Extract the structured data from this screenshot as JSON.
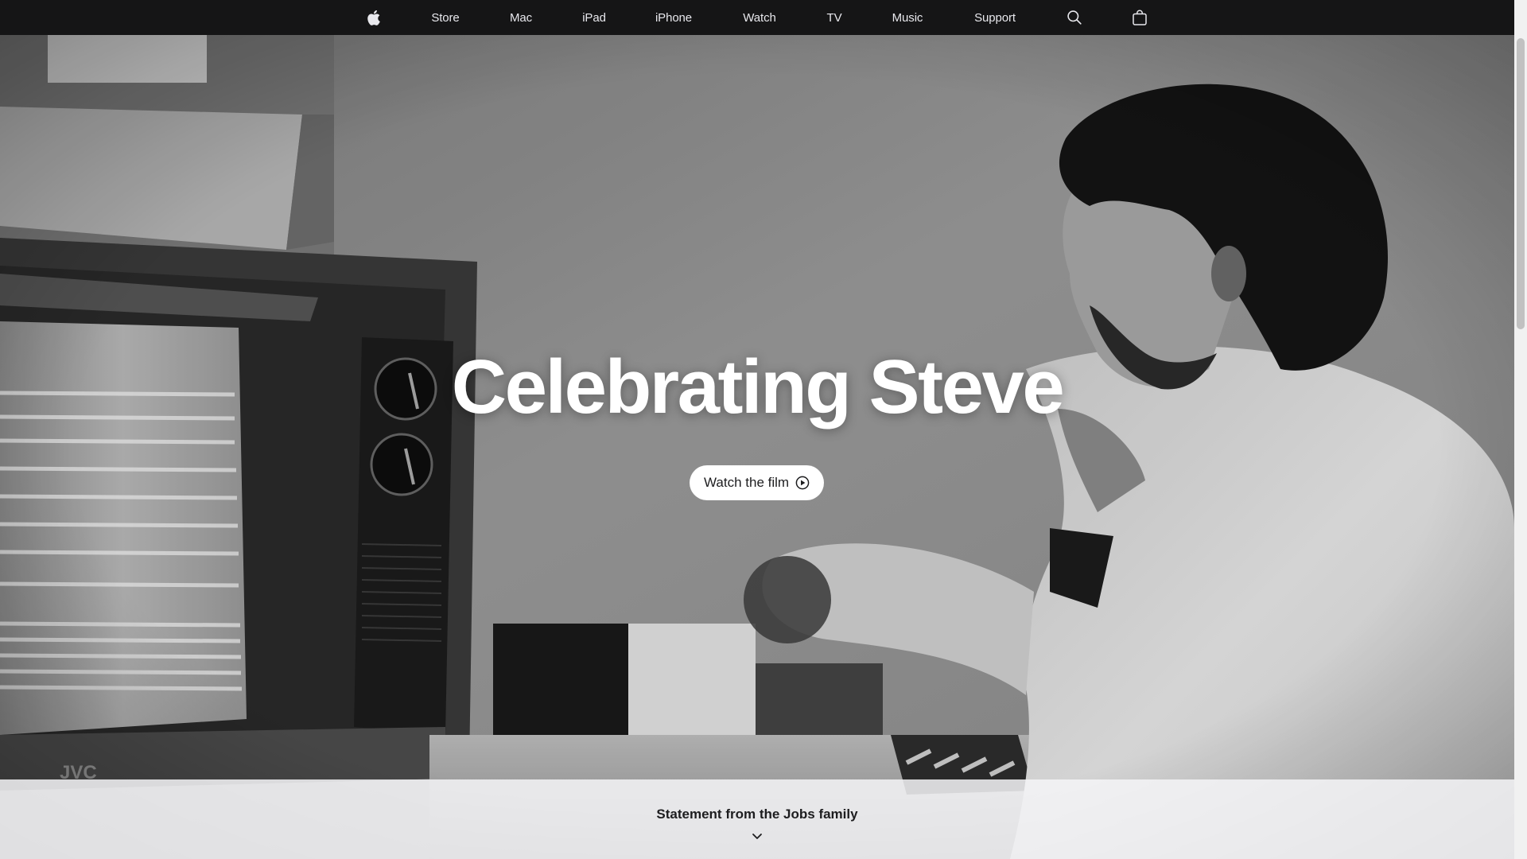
{
  "nav": {
    "apple_logo": "apple-icon",
    "items": [
      {
        "label": "Store"
      },
      {
        "label": "Mac"
      },
      {
        "label": "iPad"
      },
      {
        "label": "iPhone"
      },
      {
        "label": "Watch"
      },
      {
        "label": "TV"
      },
      {
        "label": "Music"
      },
      {
        "label": "Support"
      }
    ],
    "search_icon": "search-icon",
    "bag_icon": "bag-icon"
  },
  "hero": {
    "title": "Celebrating Steve",
    "cta_label": "Watch the film",
    "cta_icon": "play-circle-icon",
    "photo_tone": "black-and-white"
  },
  "statement": {
    "label": "Statement from the Jobs family",
    "chevron_icon": "chevron-down-icon"
  },
  "colors": {
    "nav_background": "#161617",
    "nav_text": "#e8e8ed",
    "hero_title": "#ffffff",
    "button_background": "#ffffff",
    "button_text": "#1d1d1f",
    "statement_background": "#f5f5f7"
  }
}
